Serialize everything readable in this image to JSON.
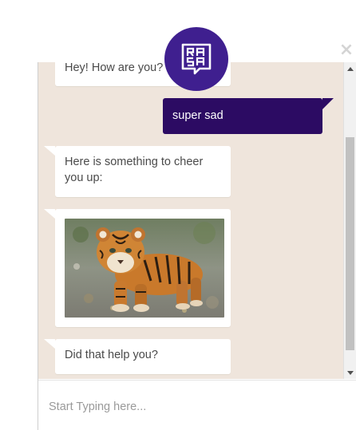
{
  "close_icon": "×",
  "avatar": {
    "logo_text": "RASA",
    "icon": "rasa-logo-icon",
    "color": "#3f1f8f"
  },
  "messages": [
    {
      "sender": "bot",
      "text": "Hey! How are you?"
    },
    {
      "sender": "user",
      "text": "super sad"
    },
    {
      "sender": "bot",
      "text": "Here is something to cheer you up:"
    },
    {
      "sender": "bot",
      "type": "image",
      "icon": "tiger-cub-image"
    },
    {
      "sender": "bot",
      "text": "Did that help you?"
    }
  ],
  "input": {
    "placeholder": "Start Typing here..."
  },
  "colors": {
    "chat_bg": "#efe5dc",
    "user_bubble": "#2c0b63",
    "bot_bubble": "#ffffff"
  }
}
